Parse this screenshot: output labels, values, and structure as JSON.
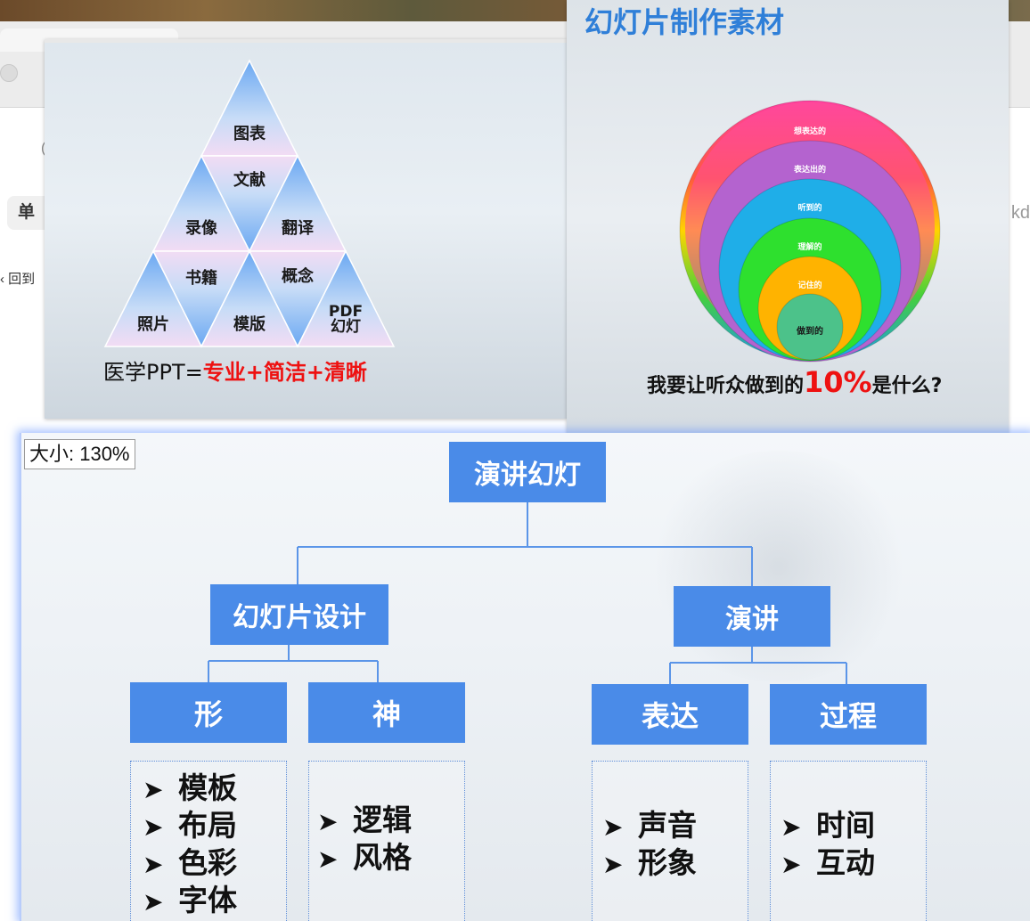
{
  "background": {
    "pill_label": "单",
    "back_link": "回到",
    "right_fragment": "kd",
    "circle_fragment": "("
  },
  "slide1": {
    "pyramid_labels": {
      "top": "图表",
      "row2": "文献",
      "row3_left": "录像",
      "row3_right": "翻译",
      "row4_left": "书籍",
      "row4_right": "概念",
      "row5_left": "照片",
      "row5_mid": "模版",
      "row5_right_line1": "PDF",
      "row5_right_line2": "幻灯"
    },
    "caption_prefix": "医学PPT=",
    "caption_highlight": "专业+简洁+清晰"
  },
  "slide2": {
    "title": "幻灯片制作素材",
    "circles": [
      {
        "label": "想表达的",
        "color": "#ff4f9a"
      },
      {
        "label": "表达出的",
        "color": "#b463cf"
      },
      {
        "label": "听到的",
        "color": "#1faee8"
      },
      {
        "label": "理解的",
        "color": "#2ee02e"
      },
      {
        "label": "记住的",
        "color": "#ffb300"
      },
      {
        "label": "做到的",
        "color": "#4cc28a"
      }
    ],
    "caption_prefix": "我要让听众做到的",
    "caption_percent": "10%",
    "caption_suffix": "是什么?"
  },
  "viewer": {
    "zoom_label": "大小: 130%",
    "root": "演讲幻灯",
    "left_branch": {
      "label": "幻灯片设计",
      "children": [
        {
          "label": "形",
          "items": [
            "模板",
            "布局",
            "色彩",
            "字体"
          ]
        },
        {
          "label": "神",
          "items": [
            "逻辑",
            "风格"
          ]
        }
      ]
    },
    "right_branch": {
      "label": "演讲",
      "children": [
        {
          "label": "表达",
          "items": [
            "声音",
            "形象"
          ]
        },
        {
          "label": "过程",
          "items": [
            "时间",
            "互动"
          ]
        }
      ]
    },
    "bullet_glyph": "➤",
    "colors": {
      "node": "#4a8be8",
      "line": "#4a8be8"
    }
  }
}
